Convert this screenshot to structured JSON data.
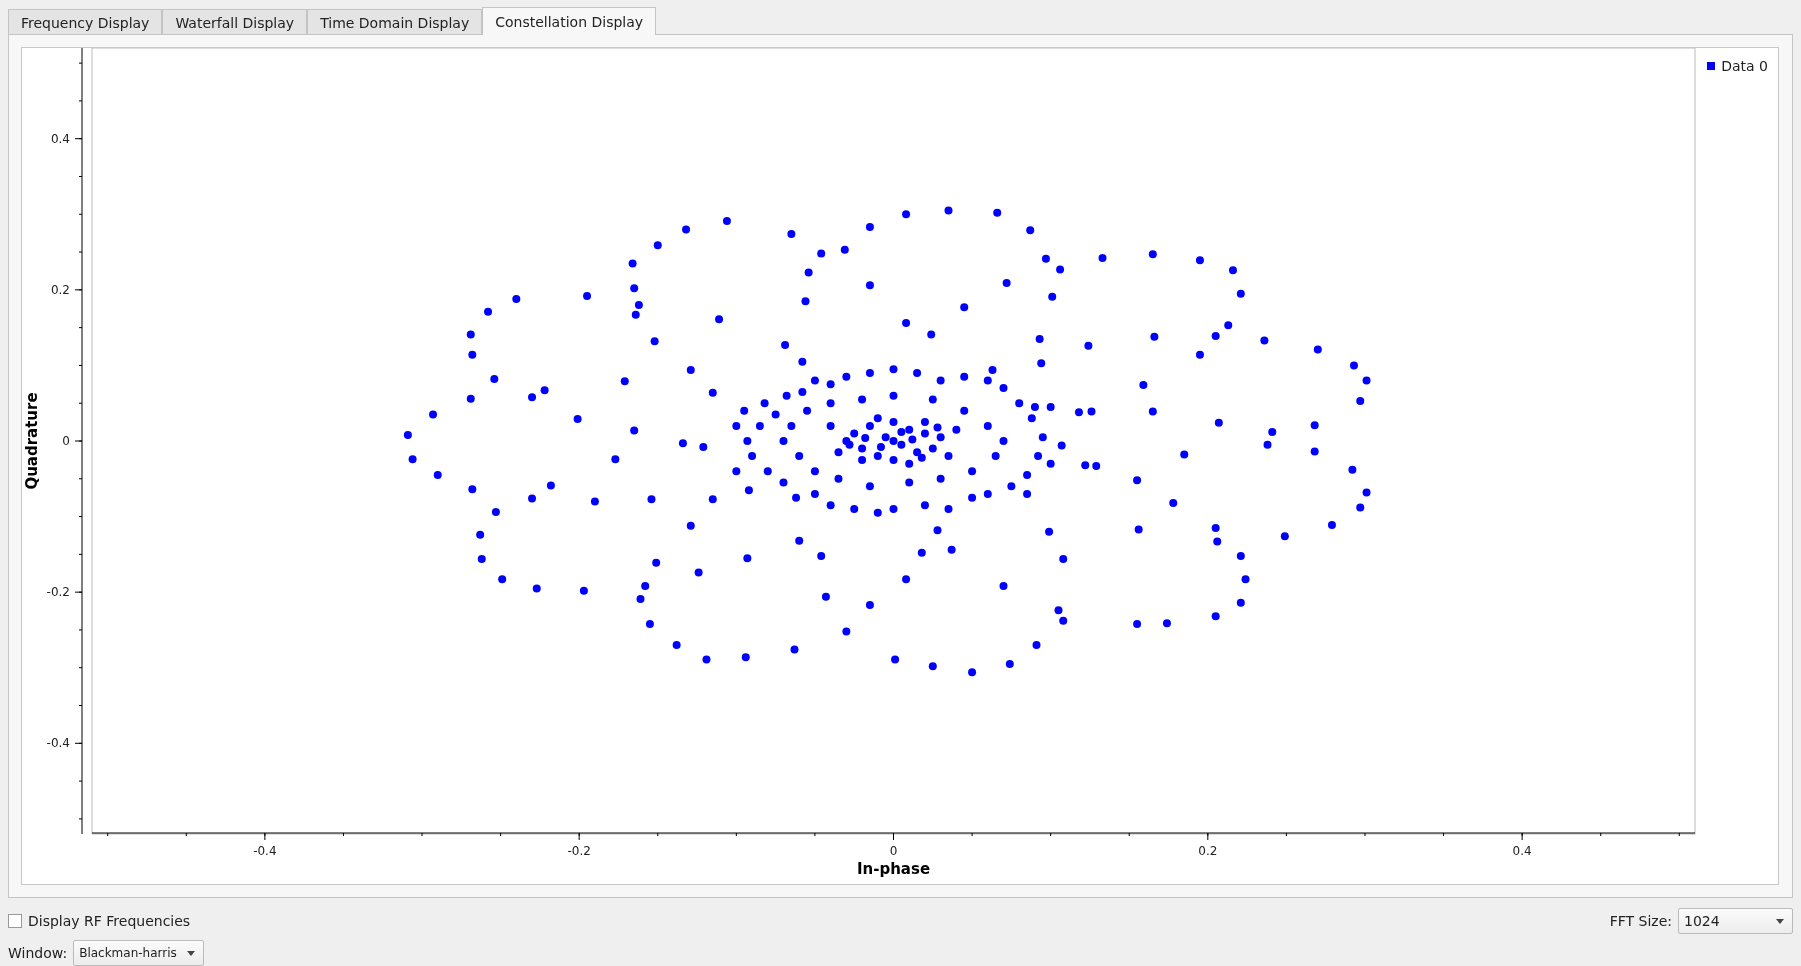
{
  "tabs": [
    {
      "label": "Frequency Display",
      "selected": false
    },
    {
      "label": "Waterfall Display",
      "selected": false
    },
    {
      "label": "Time Domain Display",
      "selected": false
    },
    {
      "label": "Constellation Display",
      "selected": true
    }
  ],
  "plot": {
    "chart_data": {
      "type": "scatter",
      "xlabel": "In-phase",
      "ylabel": "Quadrature",
      "xlim": [
        -0.51,
        0.51
      ],
      "ylim": [
        -0.52,
        0.52
      ],
      "xticks": [
        {
          "value": -0.4,
          "label": "-0.4"
        },
        {
          "value": -0.2,
          "label": "-0.2"
        },
        {
          "value": 0,
          "label": "0"
        },
        {
          "value": 0.2,
          "label": "0.2"
        },
        {
          "value": 0.4,
          "label": "0.4"
        }
      ],
      "yticks": [
        {
          "value": 0.4,
          "label": "0.4"
        },
        {
          "value": 0.2,
          "label": "0.2"
        },
        {
          "value": 0,
          "label": "0"
        },
        {
          "value": -0.2,
          "label": "-0.2"
        },
        {
          "value": -0.4,
          "label": "-0.4"
        }
      ],
      "x": [
        -0.309,
        -0.306,
        -0.293,
        -0.29,
        -0.269,
        -0.268,
        -0.269,
        -0.268,
        -0.263,
        -0.262,
        -0.258,
        -0.254,
        -0.253,
        -0.249,
        -0.24,
        -0.23,
        -0.23,
        -0.227,
        -0.222,
        -0.218,
        -0.201,
        -0.197,
        -0.195,
        -0.19,
        -0.177,
        -0.171,
        -0.166,
        -0.165,
        -0.165,
        -0.162,
        -0.164,
        -0.161,
        -0.158,
        -0.155,
        -0.154,
        -0.152,
        -0.151,
        -0.15,
        -0.138,
        -0.134,
        -0.132,
        -0.129,
        -0.129,
        -0.124,
        -0.121,
        -0.119,
        -0.115,
        -0.115,
        -0.111,
        -0.106,
        -0.094,
        -0.093,
        -0.069,
        -0.065,
        -0.063,
        -0.06,
        -0.058,
        -0.056,
        -0.054,
        -0.046,
        -0.046,
        -0.043,
        -0.031,
        -0.03,
        -0.015,
        -0.015,
        -0.015,
        0.001,
        0.008,
        0.008,
        0.008,
        0.018,
        0.024,
        0.025,
        0.028,
        0.035,
        0.037,
        0.045,
        0.05,
        0.066,
        0.063,
        0.07,
        0.072,
        0.074,
        0.087,
        0.091,
        0.093,
        0.094,
        0.097,
        0.099,
        0.1,
        0.101,
        0.105,
        0.106,
        0.107,
        0.108,
        0.108,
        0.118,
        0.122,
        0.124,
        0.126,
        0.129,
        0.133,
        0.155,
        0.156,
        0.155,
        0.159,
        0.165,
        0.165,
        0.166,
        0.174,
        0.178,
        0.185,
        0.195,
        0.195,
        0.205,
        0.205,
        0.205,
        0.206,
        0.207,
        0.213,
        0.216,
        0.221,
        0.221,
        0.221,
        0.224,
        0.236,
        0.238,
        0.241,
        0.249,
        0.268,
        0.268,
        0.27,
        0.279,
        0.292,
        0.293,
        0.297,
        0.297,
        0.301,
        0.301,
        -0.095,
        -0.093,
        -0.09,
        -0.092,
        -0.085,
        -0.08,
        -0.082,
        -0.075,
        -0.07,
        -0.068,
        -0.062,
        -0.058,
        -0.05,
        -0.05,
        -0.04,
        -0.04,
        -0.03,
        -0.025,
        -0.015,
        -0.01,
        0,
        0,
        0.015,
        0.02,
        0.03,
        0.035,
        0.045,
        0.05,
        0.06,
        0.06,
        0.07,
        0.075,
        0.08,
        0.085,
        0.088,
        0.092,
        0.095,
        0.09,
        0.1,
        0.085,
        -0.1,
        -0.1,
        -0.065,
        -0.06,
        -0.055,
        -0.05,
        -0.04,
        -0.035,
        -0.02,
        -0.015,
        0,
        0.01,
        0.025,
        0.03,
        0.045,
        0.05,
        0.06,
        0.065,
        0.07,
        -0.07,
        -0.03,
        -0.025,
        -0.02,
        -0.015,
        -0.01,
        -0.005,
        0,
        0.005,
        0.01,
        0.015,
        0.02,
        0.025,
        0.03,
        0.035,
        -0.035,
        -0.01,
        0.01,
        0,
        0,
        0.02,
        -0.02,
        0.04,
        -0.04,
        0.005,
        -0.008,
        0.012,
        -0.018,
        0.028,
        -0.028,
        0.018
      ],
      "series": [
        {
          "name": "Data 0",
          "color": "#0000ff",
          "values": [
            0.008,
            -0.024,
            0.035,
            -0.045,
            0.141,
            0.114,
            0.056,
            -0.064,
            -0.124,
            -0.156,
            0.171,
            0.082,
            -0.094,
            -0.183,
            0.188,
            0.058,
            -0.076,
            -0.195,
            0.067,
            -0.059,
            0.029,
            -0.198,
            0.192,
            -0.08,
            -0.024,
            0.079,
            0.235,
            0.202,
            0.014,
            0.18,
            0.167,
            -0.209,
            -0.192,
            -0.242,
            -0.077,
            0.132,
            -0.161,
            0.259,
            -0.27,
            -0.003,
            0.28,
            0.094,
            -0.112,
            -0.174,
            -0.008,
            -0.289,
            0.064,
            -0.077,
            0.161,
            0.291,
            -0.286,
            -0.155,
            0.127,
            0.274,
            -0.276,
            -0.132,
            0.105,
            0.185,
            0.223,
            0.248,
            -0.152,
            -0.206,
            0.253,
            -0.252,
            0.283,
            0.206,
            -0.217,
            -0.289,
            0.3,
            0.156,
            -0.183,
            -0.148,
            0.141,
            -0.298,
            -0.118,
            0.305,
            -0.144,
            0.177,
            -0.306,
            0.302,
            0.094,
            -0.192,
            0.209,
            -0.295,
            0.279,
            -0.27,
            0.135,
            0.103,
            0.241,
            -0.12,
            0.045,
            0.191,
            -0.224,
            0.227,
            -0.006,
            -0.238,
            -0.156,
            0.038,
            -0.032,
            0.126,
            0.039,
            -0.033,
            0.242,
            -0.052,
            -0.117,
            -0.242,
            0.074,
            0.247,
            0.039,
            0.138,
            -0.241,
            -0.082,
            -0.018,
            0.114,
            0.239,
            -0.232,
            0.139,
            -0.115,
            -0.133,
            0.024,
            0.153,
            0.226,
            0.195,
            -0.152,
            -0.214,
            -0.183,
            0.133,
            -0.005,
            0.012,
            -0.126,
            -0.014,
            0.021,
            0.121,
            -0.111,
            -0.038,
            0.1,
            0.053,
            -0.088,
            0.08,
            -0.068,
            0.04,
            0,
            -0.02,
            -0.065,
            0.02,
            -0.04,
            0.05,
            0.035,
            -0.055,
            0.06,
            -0.075,
            0.065,
            0.08,
            -0.07,
            0.075,
            -0.085,
            0.085,
            -0.09,
            0.09,
            -0.095,
            0.095,
            -0.09,
            0.09,
            -0.085,
            0.08,
            -0.09,
            0.085,
            -0.075,
            0.08,
            -0.07,
            0.07,
            -0.06,
            0.05,
            -0.045,
            0.03,
            -0.02,
            0.005,
            0.045,
            -0.03,
            -0.07,
            0.02,
            -0.04,
            0.02,
            -0.02,
            0.04,
            -0.04,
            0.05,
            -0.05,
            0.055,
            -0.06,
            0.06,
            -0.055,
            0.055,
            -0.05,
            0.04,
            -0.04,
            0.02,
            -0.02,
            0,
            0,
            0,
            0.01,
            -0.01,
            0.02,
            -0.02,
            0.005,
            0,
            -0.005,
            0.015,
            -0.015,
            0.01,
            -0.01,
            0.005,
            -0.02,
            -0.015,
            0.03,
            -0.03,
            0.025,
            -0.025,
            0.025,
            -0.025,
            0.015,
            0.02,
            0.012,
            -0.008,
            0.002,
            0.004,
            0.018,
            -0.005,
            -0.022
          ]
        }
      ]
    }
  },
  "controls": {
    "rf_checkbox": {
      "label": "Display RF Frequencies",
      "checked": false
    },
    "fft_size": {
      "label": "FFT Size:",
      "value": "1024"
    },
    "window": {
      "label": "Window:",
      "value": "Blackman-harris"
    }
  }
}
